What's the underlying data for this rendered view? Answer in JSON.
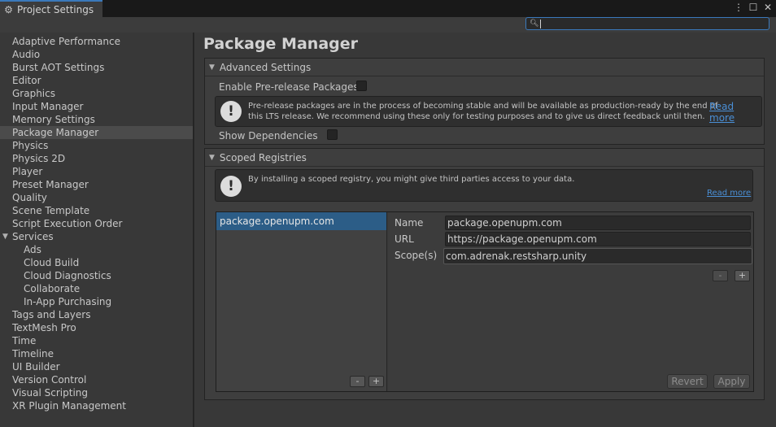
{
  "window": {
    "tab_title": "Project Settings",
    "menu_icon": "kebab-menu-icon",
    "maximize_icon": "maximize-icon",
    "close_icon": "close-icon"
  },
  "search": {
    "value": "",
    "icon": "search-icon"
  },
  "sidebar": {
    "items": [
      {
        "label": "Adaptive Performance"
      },
      {
        "label": "Audio"
      },
      {
        "label": "Burst AOT Settings"
      },
      {
        "label": "Editor"
      },
      {
        "label": "Graphics"
      },
      {
        "label": "Input Manager"
      },
      {
        "label": "Memory Settings"
      },
      {
        "label": "Package Manager",
        "selected": true
      },
      {
        "label": "Physics"
      },
      {
        "label": "Physics 2D"
      },
      {
        "label": "Player"
      },
      {
        "label": "Preset Manager"
      },
      {
        "label": "Quality"
      },
      {
        "label": "Scene Template"
      },
      {
        "label": "Script Execution Order"
      },
      {
        "label": "Services",
        "expanded": true
      },
      {
        "label": "Ads",
        "child": true
      },
      {
        "label": "Cloud Build",
        "child": true
      },
      {
        "label": "Cloud Diagnostics",
        "child": true
      },
      {
        "label": "Collaborate",
        "child": true
      },
      {
        "label": "In-App Purchasing",
        "child": true
      },
      {
        "label": "Tags and Layers"
      },
      {
        "label": "TextMesh Pro"
      },
      {
        "label": "Time"
      },
      {
        "label": "Timeline"
      },
      {
        "label": "UI Builder"
      },
      {
        "label": "Version Control"
      },
      {
        "label": "Visual Scripting"
      },
      {
        "label": "XR Plugin Management"
      }
    ]
  },
  "main": {
    "title": "Package Manager",
    "advanced": {
      "header": "Advanced Settings",
      "prerelease_label": "Enable Pre-release Packages",
      "prerelease_checked": false,
      "help_line1": "Pre-release packages are in the process of becoming stable and will be available as production-ready by the end of",
      "help_line2": "this LTS release. We recommend using these only for testing purposes and to give us direct feedback until then.",
      "read_more": "Read more",
      "show_deps_label": "Show Dependencies",
      "show_deps_checked": false
    },
    "scoped": {
      "header": "Scoped Registries",
      "help_text": "By installing a scoped registry, you might give third parties access to your data.",
      "read_more": "Read more",
      "registries": [
        "package.openupm.com"
      ],
      "list_remove": "-",
      "list_add": "+",
      "name_label": "Name",
      "name_value": "package.openupm.com",
      "url_label": "URL",
      "url_value": "https://package.openupm.com",
      "scopes_label": "Scope(s)",
      "scope_value": "com.adrenak.restsharp.unity",
      "scope_remove": "-",
      "scope_add": "+",
      "revert_label": "Revert",
      "apply_label": "Apply"
    }
  }
}
